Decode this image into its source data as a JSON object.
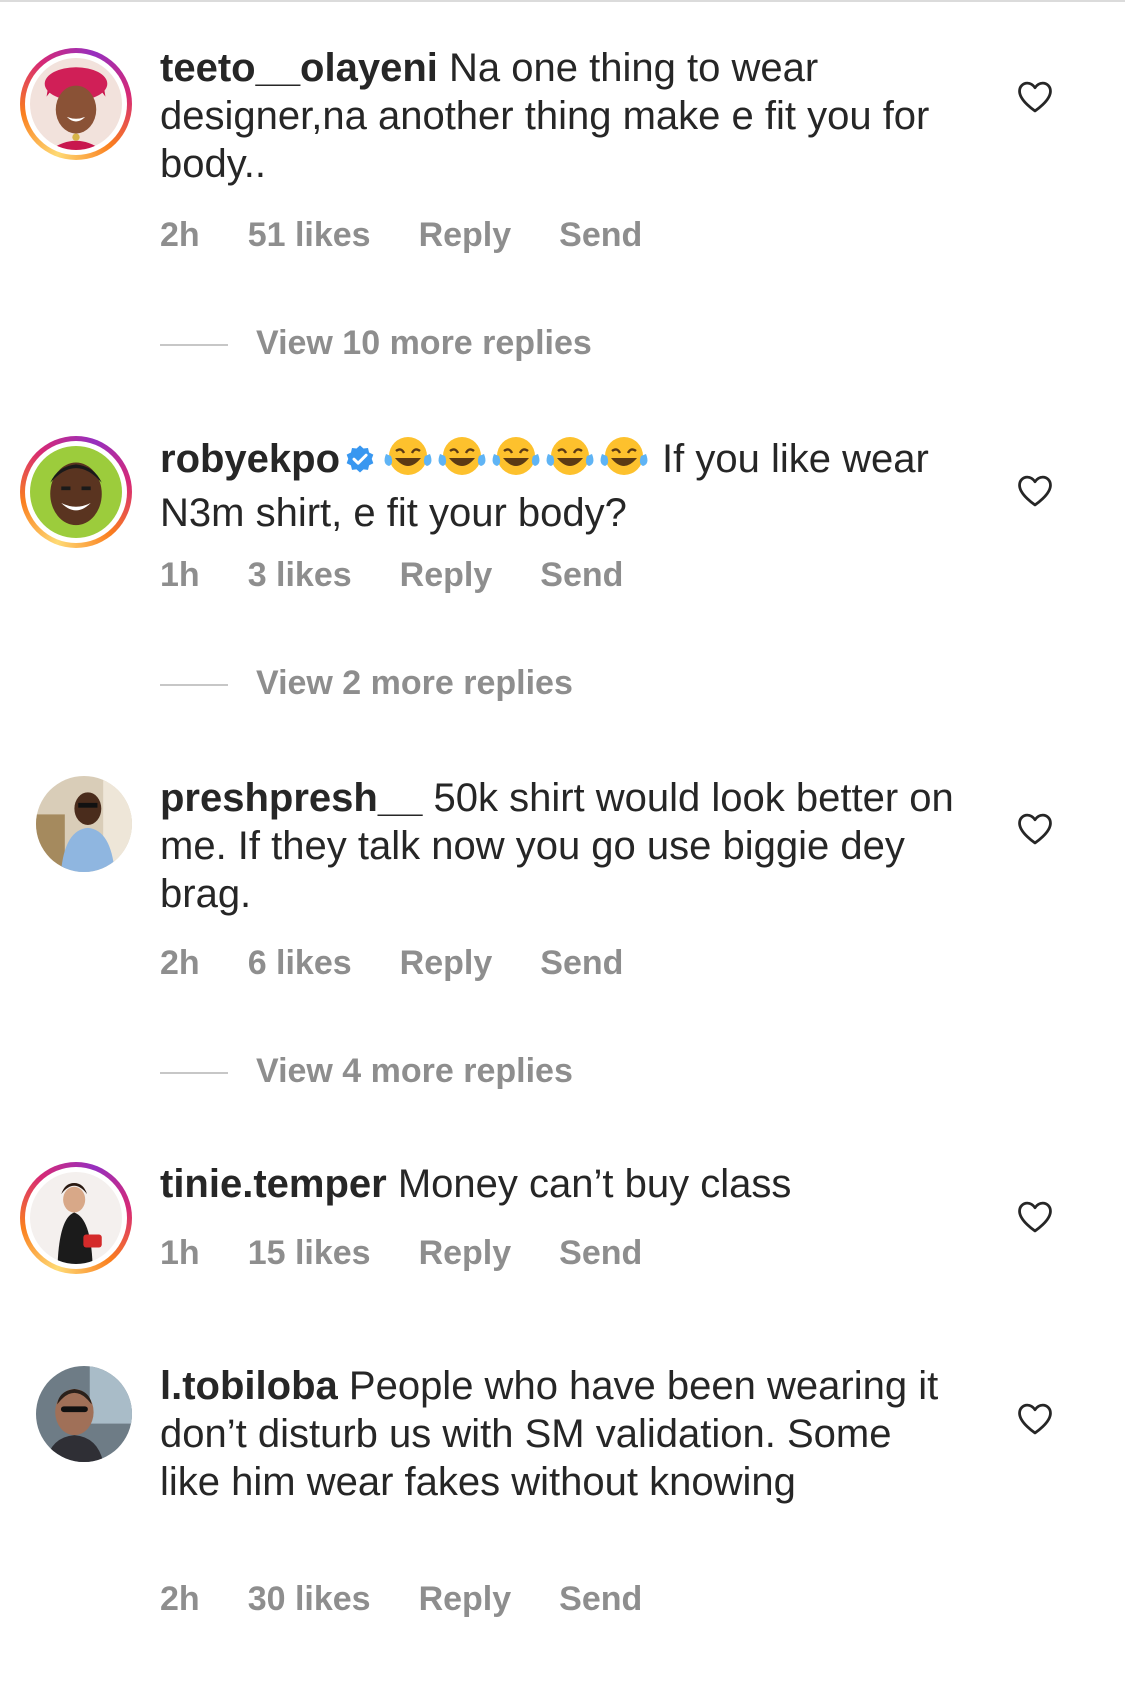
{
  "comments": [
    {
      "username": "teeto__olayeni",
      "text": "Na one thing to wear designer,na another thing make e fit you for body..",
      "time": "2h",
      "likes": "51 likes",
      "reply": "Reply",
      "send": "Send",
      "view_replies": "View 10 more replies"
    },
    {
      "username": "robyekpo",
      "emojis": "😂😂😂😂😂",
      "text": "If you like wear N3m shirt, e fit your body?",
      "time": "1h",
      "likes": "3 likes",
      "reply": "Reply",
      "send": "Send",
      "view_replies": "View 2 more replies"
    },
    {
      "username": "preshpresh__",
      "text": "50k shirt would look better on me. If they talk now you go use biggie dey brag.",
      "time": "2h",
      "likes": "6 likes",
      "reply": "Reply",
      "send": "Send",
      "view_replies": "View 4 more replies"
    },
    {
      "username": "tinie.temper",
      "text": "Money can’t buy class",
      "time": "1h",
      "likes": "15 likes",
      "reply": "Reply",
      "send": "Send"
    },
    {
      "username": "l.tobiloba",
      "text": "People who have been wearing it don’t disturb us with SM validation. Some like him wear fakes without knowing",
      "time": "2h",
      "likes": "30 likes",
      "reply": "Reply",
      "send": "Send"
    }
  ],
  "colors": {
    "text": "#262626",
    "meta": "#8e8e8e",
    "verified": "#3897f0"
  }
}
